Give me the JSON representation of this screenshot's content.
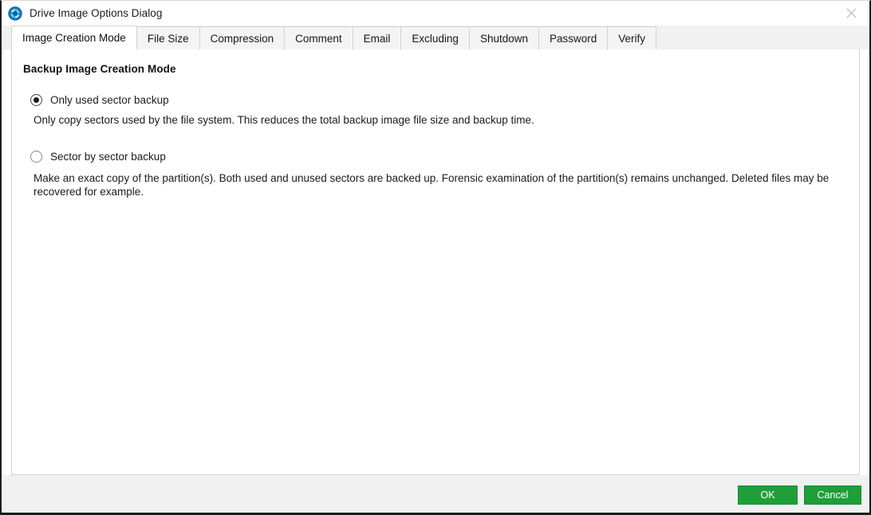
{
  "window": {
    "title": "Drive Image Options Dialog",
    "app_icon": "refresh-circle-icon",
    "close_icon": "close-icon"
  },
  "tabs": [
    {
      "label": "Image Creation Mode",
      "active": true
    },
    {
      "label": "File Size",
      "active": false
    },
    {
      "label": "Compression",
      "active": false
    },
    {
      "label": "Comment",
      "active": false
    },
    {
      "label": "Email",
      "active": false
    },
    {
      "label": "Excluding",
      "active": false
    },
    {
      "label": "Shutdown",
      "active": false
    },
    {
      "label": "Password",
      "active": false
    },
    {
      "label": "Verify",
      "active": false
    }
  ],
  "content": {
    "section_title": "Backup Image Creation Mode",
    "options": [
      {
        "label": "Only used sector backup",
        "selected": true,
        "description": "Only copy sectors used by the file system. This reduces the total backup image file size and backup time."
      },
      {
        "label": "Sector by sector backup",
        "selected": false,
        "description": "Make an exact copy of the partition(s). Both used and unused sectors are backed up. Forensic examination of the partition(s) remains unchanged. Deleted files may be recovered for example."
      }
    ]
  },
  "footer": {
    "ok_label": "OK",
    "cancel_label": "Cancel"
  },
  "colors": {
    "button_green": "#1f9e39",
    "button_green_border": "#1a8c31",
    "chrome_gray": "#f1f1f1",
    "panel_border": "#d2d2d2",
    "icon_blue": "#1279bf"
  }
}
